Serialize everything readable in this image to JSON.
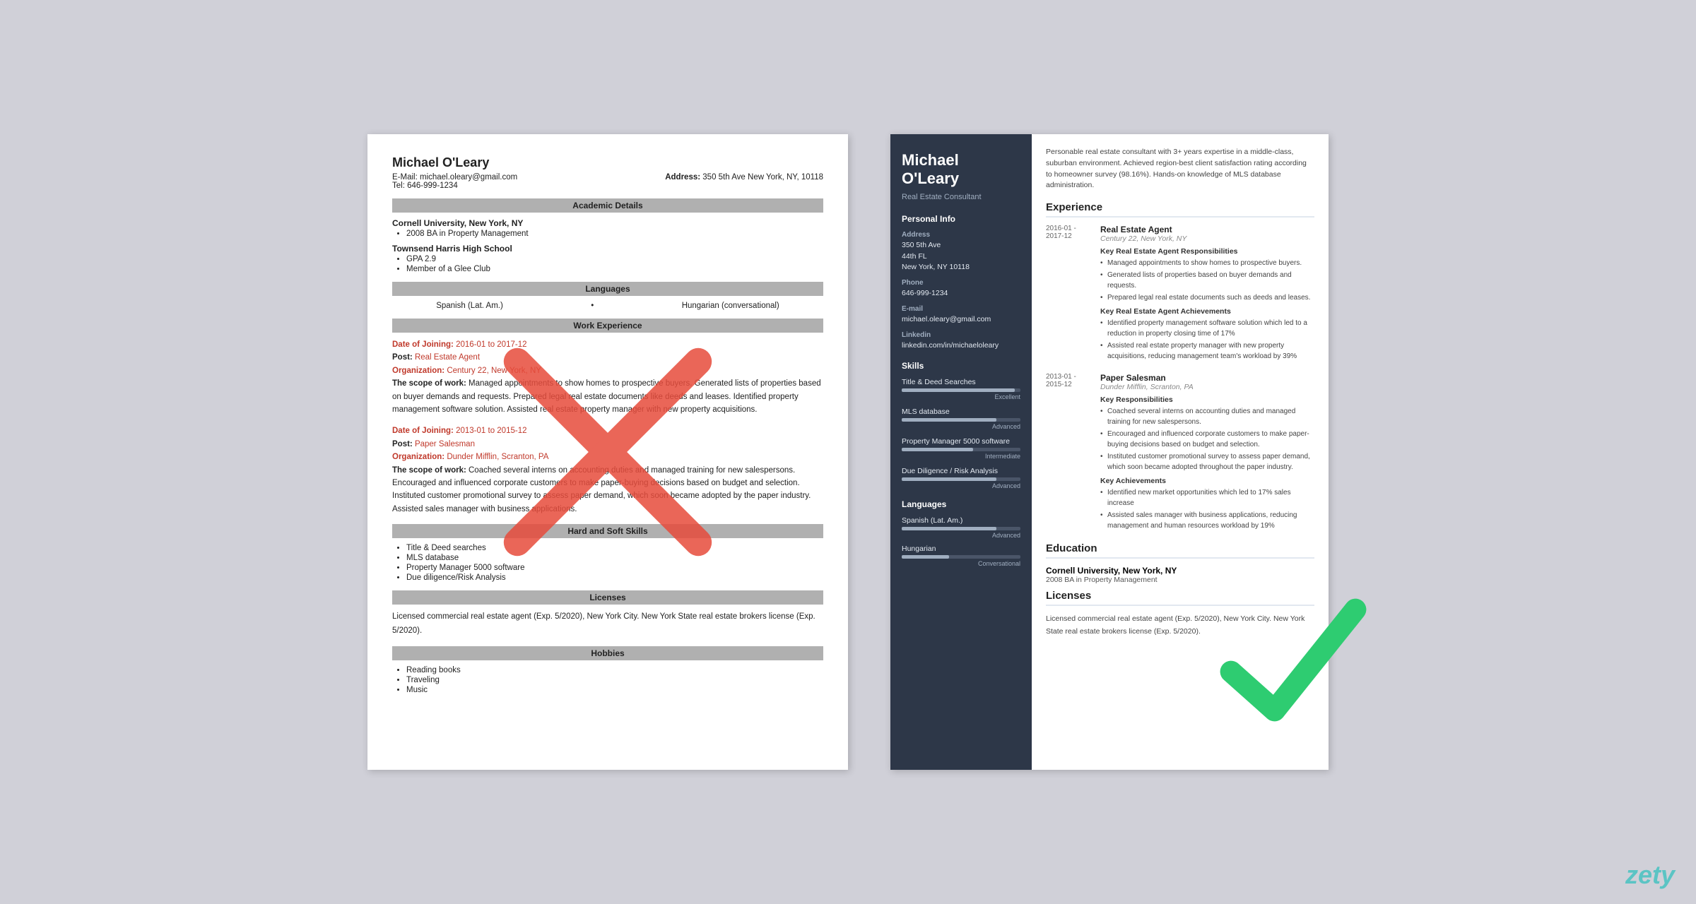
{
  "left_resume": {
    "name": "Michael O'Leary",
    "email_label": "E-Mail:",
    "email": "michael.oleary@gmail.com",
    "address_label": "Address:",
    "address": "350 5th Ave New York, NY, 10118",
    "tel_label": "Tel:",
    "tel": "646-999-1234",
    "sections": {
      "academic": "Academic Details",
      "languages": "Languages",
      "work": "Work Experience",
      "skills": "Hard and Soft Skills",
      "licenses": "Licenses",
      "hobbies": "Hobbies"
    },
    "education": [
      {
        "school": "Cornell University, New York, NY",
        "items": [
          "2008 BA in Property Management"
        ]
      },
      {
        "school": "Townsend Harris High School",
        "items": [
          "GPA 2.9",
          "Member of a Glee Club"
        ]
      }
    ],
    "languages": [
      "Spanish (Lat. Am.)",
      "Hungarian (conversational)"
    ],
    "work_entries": [
      {
        "date_label": "Date of Joining:",
        "date": "2016-01 to 2017-12",
        "post_label": "Post:",
        "post": "Real Estate Agent",
        "org_label": "Organization:",
        "org": "Century 22, New York, NY",
        "scope_label": "The scope of work:",
        "scope": "Managed appointments to show homes to prospective buyers. Generated lists of properties based on buyer demands and requests. Prepared legal real estate documents like deeds and leases. Identified property management software solution. Assisted real estate property manager with new property acquisitions."
      },
      {
        "date_label": "Date of Joining:",
        "date": "2013-01 to 2015-12",
        "post_label": "Post:",
        "post": "Paper Salesman",
        "org_label": "Organization:",
        "org": "Dunder Mifflin, Scranton, PA",
        "scope_label": "The scope of work:",
        "scope": "Coached several interns on accounting duties and managed training for new salespersons. Encouraged and influenced corporate customers to make paper-buying decisions based on budget and selection. Instituted customer promotional survey to assess paper demand, which soon became adopted by the paper industry. Assisted sales manager with business applications."
      }
    ],
    "skills": [
      "Title & Deed searches",
      "MLS database",
      "Property Manager 5000 software",
      "Due diligence/Risk Analysis"
    ],
    "licenses_text": "Licensed commercial real estate agent (Exp. 5/2020), New York City.\nNew York State real estate brokers license (Exp. 5/2020).",
    "hobbies": [
      "Reading books",
      "Traveling",
      "Music"
    ]
  },
  "right_resume": {
    "name": "Michael\nO'Leary",
    "title": "Real Estate Consultant",
    "summary": "Personable real estate consultant with 3+ years expertise in a middle-class, suburban environment. Achieved region-best client satisfaction rating according to homeowner survey (98.16%). Hands-on knowledge of MLS database administration.",
    "personal_info_title": "Personal Info",
    "address_label": "Address",
    "address_lines": [
      "350 5th Ave",
      "44th FL",
      "New York, NY 10118"
    ],
    "phone_label": "Phone",
    "phone": "646-999-1234",
    "email_label": "E-mail",
    "email": "michael.oleary@gmail.com",
    "linkedin_label": "Linkedin",
    "linkedin": "linkedin.com/in/michaeloleary",
    "skills_title": "Skills",
    "skills": [
      {
        "name": "Title & Deed Searches",
        "pct": 95,
        "level": "Excellent"
      },
      {
        "name": "MLS database",
        "pct": 80,
        "level": "Advanced"
      },
      {
        "name": "Property Manager 5000 software",
        "pct": 60,
        "level": "Intermediate"
      },
      {
        "name": "Due Diligence / Risk Analysis",
        "pct": 80,
        "level": "Advanced"
      }
    ],
    "languages_title": "Languages",
    "languages": [
      {
        "name": "Spanish (Lat. Am.)",
        "pct": 80,
        "level": "Advanced"
      },
      {
        "name": "Hungarian",
        "pct": 40,
        "level": "Conversational"
      }
    ],
    "experience_title": "Experience",
    "experience": [
      {
        "dates": "2016-01 -\n2017-12",
        "job_title": "Real Estate Agent",
        "company": "Century 22, New York, NY",
        "responsibilities_title": "Key Real Estate Agent Responsibilities",
        "responsibilities": [
          "Managed appointments to show homes to prospective buyers.",
          "Generated lists of properties based on buyer demands and requests.",
          "Prepared legal real estate documents such as deeds and leases."
        ],
        "achievements_title": "Key Real Estate Agent Achievements",
        "achievements": [
          "Identified property management software solution which led to a reduction in property closing time of 17%",
          "Assisted real estate property manager with new property acquisitions, reducing management team's workload by 39%"
        ]
      },
      {
        "dates": "2013-01 -\n2015-12",
        "job_title": "Paper Salesman",
        "company": "Dunder Mifflin, Scranton, PA",
        "responsibilities_title": "Key Responsibilities",
        "responsibilities": [
          "Coached several interns on accounting duties and managed training for new salespersons.",
          "Encouraged and influenced corporate customers to make paper-buying decisions based on budget and selection.",
          "Instituted customer promotional survey to assess paper demand, which soon became adopted throughout the paper industry."
        ],
        "achievements_title": "Key Achievements",
        "achievements": [
          "Identified new market opportunities which led to 17% sales increase",
          "Assisted sales manager with business applications, reducing management and human resources workload by 19%"
        ]
      }
    ],
    "education_title": "Education",
    "education": [
      {
        "school": "Cornell University, New York, NY",
        "degree": "2008 BA in Property Management"
      }
    ],
    "licenses_title": "Licenses",
    "licenses_text": "Licensed commercial real estate agent (Exp. 5/2020), New York City.\nNew York State real estate brokers license (Exp. 5/2020)."
  },
  "brand": "zety"
}
